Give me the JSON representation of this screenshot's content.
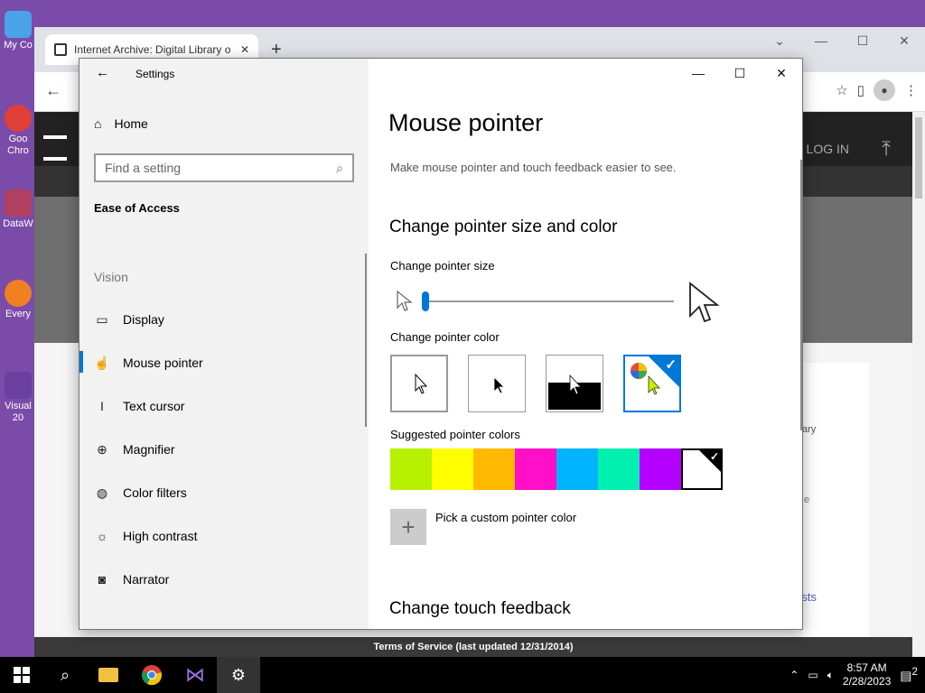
{
  "desktop": {
    "icons": [
      {
        "label": "My Co"
      },
      {
        "label": "Goo Chro"
      },
      {
        "label": "DataW"
      },
      {
        "label": "Every"
      },
      {
        "label": "Visual 20"
      }
    ]
  },
  "browser": {
    "tab_title": "Internet Archive: Digital Library o",
    "new_tab": "+",
    "ia_login": "P | LOG IN",
    "side_text_1": "ary",
    "side_text_2": "e",
    "side_link": "osts",
    "footer": "Terms of Service (last updated 12/31/2014)"
  },
  "settings": {
    "window_title": "Settings",
    "nav": {
      "home": "Home",
      "search_placeholder": "Find a setting",
      "section": "Ease of Access",
      "group": "Vision",
      "items": [
        {
          "label": "Display",
          "icon": "monitor-icon"
        },
        {
          "label": "Mouse pointer",
          "icon": "mouse-pointer-icon"
        },
        {
          "label": "Text cursor",
          "icon": "text-cursor-icon"
        },
        {
          "label": "Magnifier",
          "icon": "magnifier-icon"
        },
        {
          "label": "Color filters",
          "icon": "palette-icon"
        },
        {
          "label": "High contrast",
          "icon": "sun-icon"
        },
        {
          "label": "Narrator",
          "icon": "narrator-icon"
        }
      ]
    },
    "content": {
      "title": "Mouse pointer",
      "description": "Make mouse pointer and touch feedback easier to see.",
      "section1": "Change pointer size and color",
      "size_label": "Change pointer size",
      "pointer_size": 1,
      "color_label": "Change pointer color",
      "pointer_color_options": [
        "white",
        "black",
        "inverted",
        "custom"
      ],
      "selected_pointer_color": "custom",
      "suggested_label": "Suggested pointer colors",
      "suggested_colors": [
        "#b7f000",
        "#ffff00",
        "#ffb900",
        "#ff10c8",
        "#00b4ff",
        "#00f0b0",
        "#b400ff",
        "#ffffff"
      ],
      "selected_suggested": "#ffffff",
      "custom_color_label": "Pick a custom pointer color",
      "section2": "Change touch feedback"
    }
  },
  "taskbar": {
    "time": "8:57 AM",
    "date": "2/28/2023",
    "notification_count": "2"
  }
}
